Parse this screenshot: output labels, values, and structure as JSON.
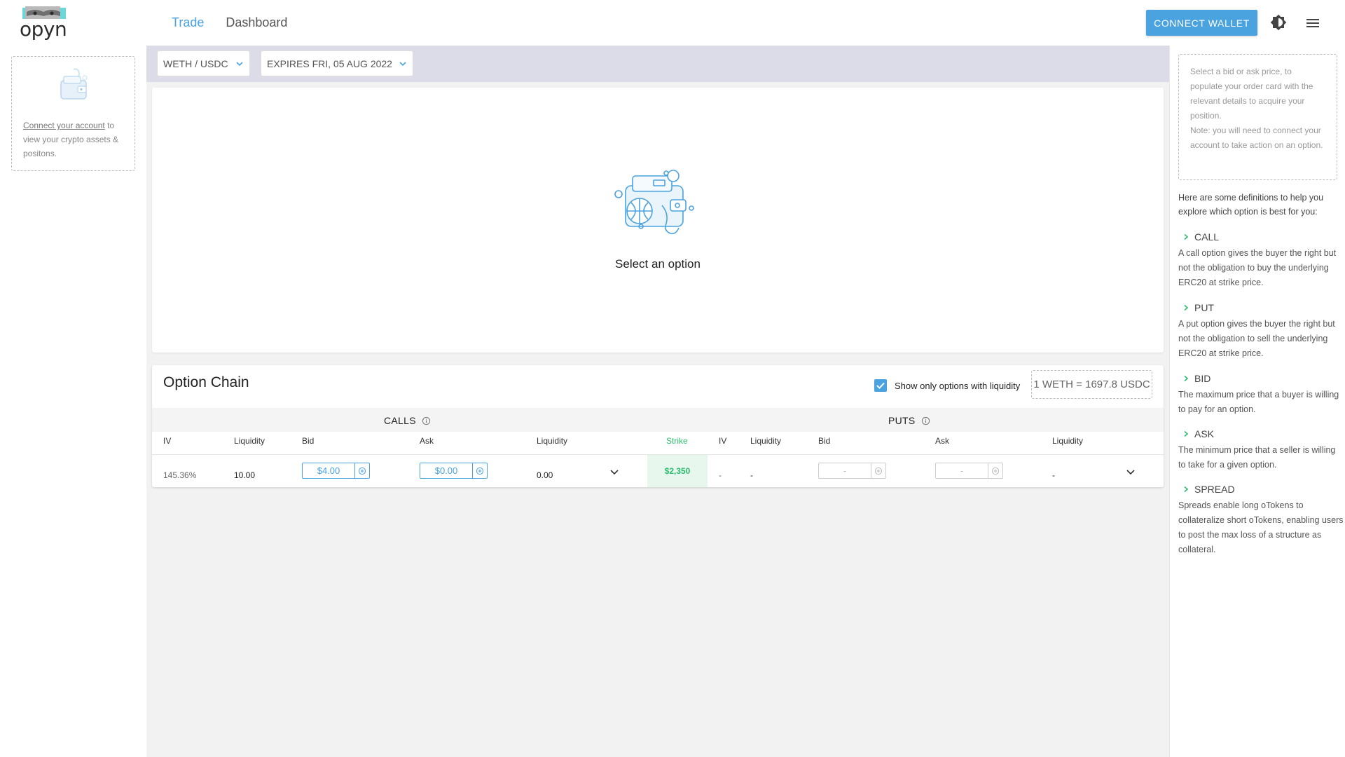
{
  "app": {
    "logo_text": "opyn"
  },
  "nav": {
    "tabs": [
      {
        "label": "Trade"
      },
      {
        "label": "Dashboard"
      }
    ]
  },
  "header": {
    "connect_label": "CONNECT WALLET"
  },
  "account": {
    "link": "Connect your account",
    "text": " to view your crypto assets & positons."
  },
  "filters": {
    "pair": "WETH / USDC",
    "expiry": "EXPIRES FRI, 05 AUG 2022"
  },
  "selection": {
    "empty_text": "Select an option"
  },
  "option_chain": {
    "title": "Option Chain",
    "liquidity_filter_label": "Show only options with liquidity",
    "liquidity_filter_checked": true,
    "spot_price": "1 WETH = 1697.8 USDC",
    "calls_label": "CALLS",
    "puts_label": "PUTS",
    "columns": {
      "calls": [
        "IV",
        "Liquidity",
        "Bid",
        "Ask",
        "Liquidity"
      ],
      "strike": "Strike",
      "puts": [
        "IV",
        "Liquidity",
        "Bid",
        "Ask",
        "Liquidity"
      ]
    },
    "rows": [
      {
        "call_iv": "145.36%",
        "call_bid_liquidity": "10.00",
        "call_bid": "$4.00",
        "call_ask": "$0.00",
        "call_ask_liquidity": "0.00",
        "strike": "$2,350",
        "put_iv": "-",
        "put_bid_liquidity": "-",
        "put_bid": "-",
        "put_ask": "-",
        "put_ask_liquidity": "-"
      }
    ]
  },
  "help": {
    "hint_1": "Select a bid or ask price, to populate your order card with the relevant details to acquire your position.",
    "hint_2": "Note: you will need to connect your account to take action on an option.",
    "intro": "Here are some definitions to help you explore which option is best for you:",
    "definitions": [
      {
        "term": "CALL",
        "text": "A call option gives the buyer the right but not the obligation to buy the underlying ERC20 at strike price."
      },
      {
        "term": "PUT",
        "text": "A put option gives the buyer the right but not the obligation to sell the underlying ERC20 at strike price."
      },
      {
        "term": "BID",
        "text": "The maximum price that a buyer is willing to pay for an option."
      },
      {
        "term": "ASK",
        "text": "The minimum price that a seller is willing to take for a given option."
      },
      {
        "term": "SPREAD",
        "text": "Spreads enable long oTokens to collateralize short oTokens, enabling users to post the max loss of a structure as collateral."
      }
    ]
  },
  "colors": {
    "accent": "#4aa3df",
    "strike_green": "#2ebd6e",
    "filter_bar": "#dcdbe8"
  },
  "icons": {
    "logo": "opyn-logo-art",
    "theme": "brightness-icon",
    "menu": "hamburger-menu-icon",
    "wallet": "wallet-icon",
    "chevron": "chevron-down-icon",
    "info": "info-icon",
    "add": "add-circle-icon",
    "check": "check-icon",
    "arrow": "chevron-right-icon"
  }
}
